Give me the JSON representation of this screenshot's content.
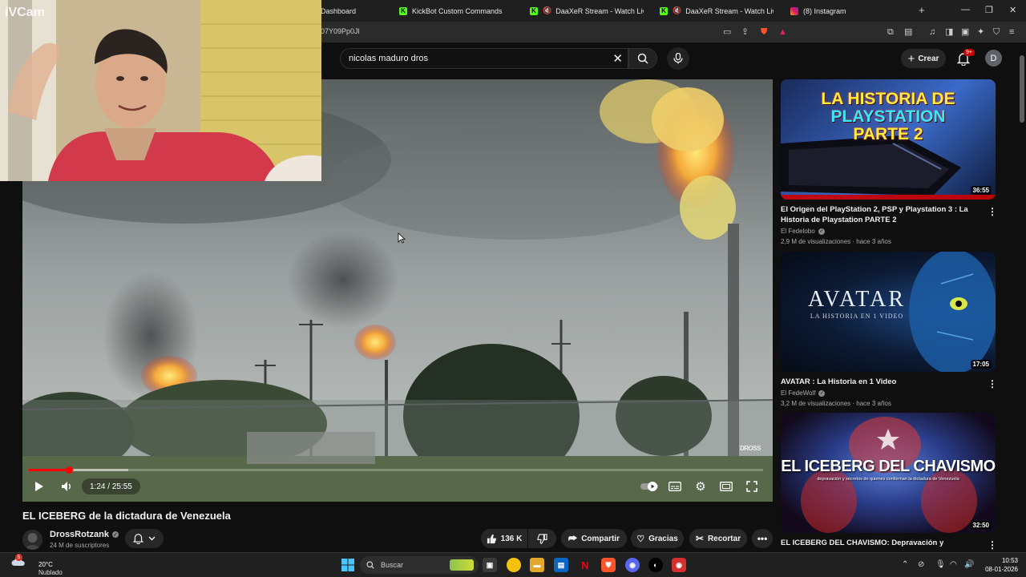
{
  "browser": {
    "tabs": [
      {
        "label": "Dashboard"
      },
      {
        "label": "KickBot Custom Commands"
      },
      {
        "label": "DaaXeR Stream - Watch Live on"
      },
      {
        "label": "DaaXeR Stream - Watch Live on"
      },
      {
        "label": "(8) Instagram"
      }
    ],
    "url": "07Y09Pp0Jl"
  },
  "webcam": {
    "label": "iVCam"
  },
  "masthead": {
    "search_query": "nicolas maduro dros",
    "create_label": "Crear",
    "notification_count": "9+",
    "account_initial": "D"
  },
  "player": {
    "time": "1:24 / 25:55",
    "progress_fraction": 0.055,
    "buffer_fraction": 0.135,
    "watermark": "DROSS"
  },
  "video": {
    "title": "EL ICEBERG de la dictadura de Venezuela",
    "channel": "DrossRotzank",
    "subscribers": "24 M de suscriptores",
    "likes": "136 K",
    "share_label": "Compartir",
    "thanks_label": "Gracias",
    "clip_label": "Recortar"
  },
  "recommendations": [
    {
      "thumb_text_1": "LA HISTORIA DE",
      "thumb_text_2": "PLAYSTATION",
      "thumb_text_3": "PARTE 2",
      "duration": "36:55",
      "title": "El Origen del PlayStation 2, PSP y Playstation 3 : La Historia de Playstation PARTE 2",
      "channel": "El Fedelobo",
      "meta": "2,9 M de visualizaciones · hace 3 años"
    },
    {
      "thumb_text_1": "AVATAR",
      "thumb_text_2": "LA HISTORIA EN 1 VIDEO",
      "duration": "17:05",
      "title": "AVATAR : La Historia en 1 Video",
      "channel": "El FedeWolf",
      "meta": "3,2 M de visualizaciones · hace 3 años"
    },
    {
      "thumb_text_1": "EL ICEBERG DEL CHAVISMO",
      "thumb_text_2": "depravación y secretos de quienes conforman la dictadura de Venezuela",
      "duration": "32:50",
      "title": "EL ICEBERG DEL CHAVISMO: Depravación y secretos de"
    }
  ],
  "taskbar": {
    "temperature": "20°C",
    "weather": "Nublado",
    "weather_badge": "5",
    "search_placeholder": "Buscar",
    "time": "10:53",
    "date": "08-01-2026"
  },
  "colors": {
    "background": "#0f0f0f",
    "accent_red": "#ff0000",
    "surface": "#272727"
  }
}
